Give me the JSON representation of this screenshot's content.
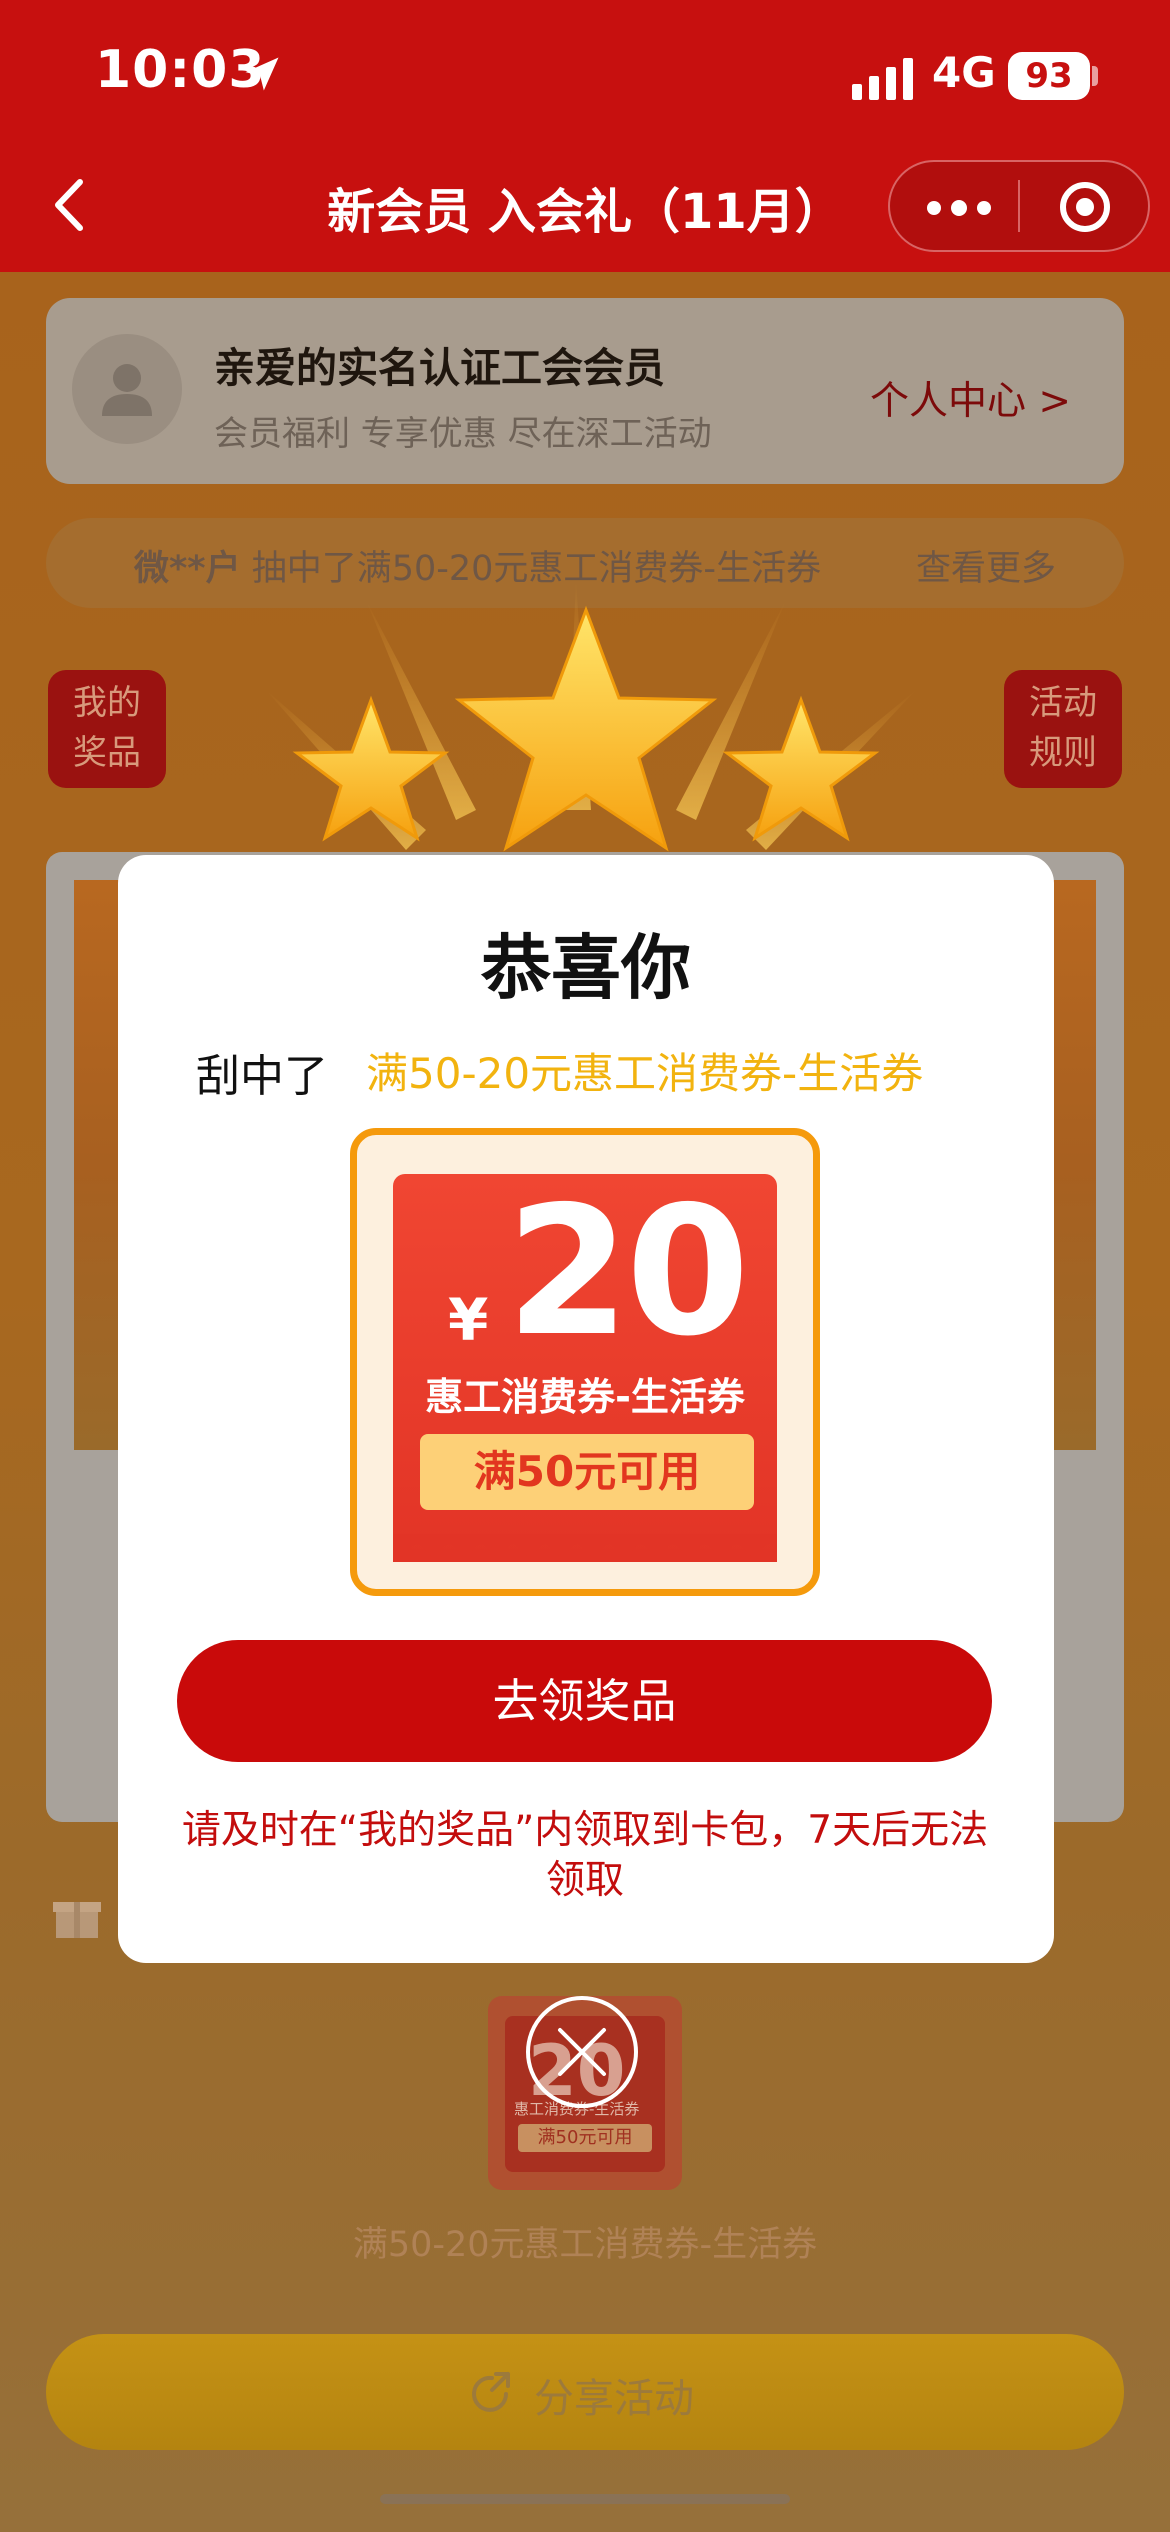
{
  "status_bar": {
    "time": "10:03",
    "network": "4G",
    "battery": "93"
  },
  "nav": {
    "title": "新会员 入会礼（11月）"
  },
  "member_card": {
    "title": "亲爱的实名认证工会会员",
    "subtitle": "会员福利 专享优惠 尽在深工活动",
    "link": "个人中心 >"
  },
  "ticker": {
    "user": "微**户",
    "text": " 抽中了满50-20元惠工消费券-生活券",
    "more": "查看更多"
  },
  "side_buttons": {
    "my_prizes": [
      "我的",
      "奖品"
    ],
    "rules": [
      "活动",
      "规则"
    ]
  },
  "thumb": {
    "amount": "20",
    "label": "惠工消费券-生活券",
    "condition": "满50元可用",
    "caption": "满50-20元惠工消费券-生活券"
  },
  "share": {
    "label": "分享活动"
  },
  "modal": {
    "title": "恭喜你",
    "won_label": "刮中了",
    "won_prize": "满50-20元惠工消费券-生活券",
    "coupon": {
      "yen": "¥",
      "amount": "20",
      "name": "惠工消费券-生活券",
      "condition": "满50元可用"
    },
    "claim_button": "去领奖品",
    "note": "请及时在“我的奖品”内领取到卡包，7天后无法领取"
  },
  "colors": {
    "brand_red": "#c7100f",
    "accent_gold": "#f2b30f",
    "coupon_orange": "#f59a0c"
  }
}
